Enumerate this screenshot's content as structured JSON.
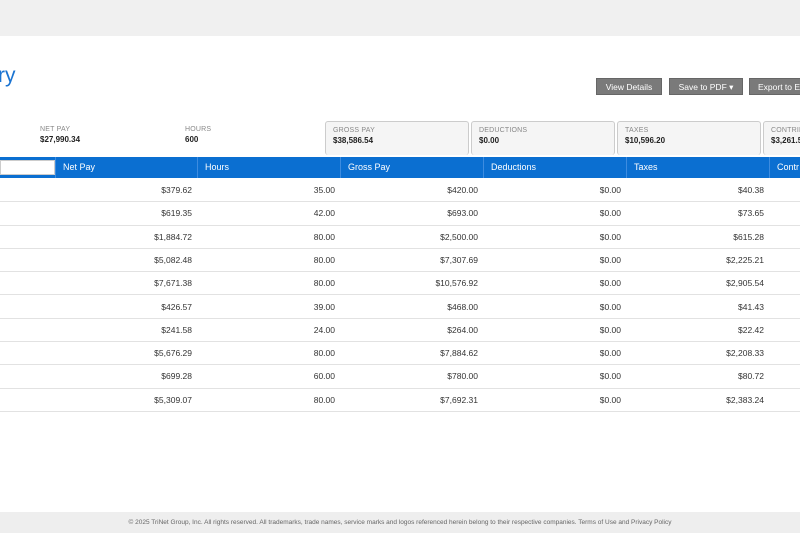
{
  "title": "ry",
  "buttons": {
    "view_details": "View Details",
    "save_pdf": "Save to PDF",
    "export": "Export to E"
  },
  "summary": [
    {
      "label": "Net Pay",
      "value": "$27,990.34"
    },
    {
      "label": "Hours",
      "value": "600"
    },
    {
      "label": "Gross Pay",
      "value": "$38,586.54"
    },
    {
      "label": "Deductions",
      "value": "$0.00"
    },
    {
      "label": "Taxes",
      "value": "$10,596.20"
    },
    {
      "label": "Contrib",
      "value": "$3,261.5"
    }
  ],
  "columns": [
    "Net Pay",
    "Hours",
    "Gross Pay",
    "Deductions",
    "Taxes",
    "Contr"
  ],
  "rows": [
    [
      "$379.62",
      "35.00",
      "$420.00",
      "$0.00",
      "$40.38"
    ],
    [
      "$619.35",
      "42.00",
      "$693.00",
      "$0.00",
      "$73.65"
    ],
    [
      "$1,884.72",
      "80.00",
      "$2,500.00",
      "$0.00",
      "$615.28"
    ],
    [
      "$5,082.48",
      "80.00",
      "$7,307.69",
      "$0.00",
      "$2,225.21"
    ],
    [
      "$7,671.38",
      "80.00",
      "$10,576.92",
      "$0.00",
      "$2,905.54"
    ],
    [
      "$426.57",
      "39.00",
      "$468.00",
      "$0.00",
      "$41.43"
    ],
    [
      "$241.58",
      "24.00",
      "$264.00",
      "$0.00",
      "$22.42"
    ],
    [
      "$5,676.29",
      "80.00",
      "$7,884.62",
      "$0.00",
      "$2,208.33"
    ],
    [
      "$699.28",
      "60.00",
      "$780.00",
      "$0.00",
      "$80.72"
    ],
    [
      "$5,309.07",
      "80.00",
      "$7,692.31",
      "$0.00",
      "$2,383.24"
    ]
  ],
  "footer": "© 2025 TriNet Group, Inc. All rights reserved. All trademarks, trade names, service marks and logos referenced herein belong to their respective companies. Terms of Use and Privacy Policy"
}
